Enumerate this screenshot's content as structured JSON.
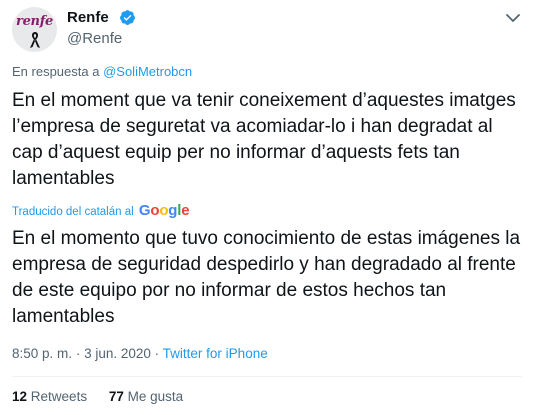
{
  "author": {
    "display_name": "Renfe",
    "handle": "@Renfe",
    "avatar_logo_text": "renfe",
    "verified_icon": "verified-badge-icon",
    "avatar_ribbon_icon": "mourning-ribbon-icon"
  },
  "reply_to": {
    "prefix": "En respuesta a",
    "user": "@SoliMetrobcn"
  },
  "tweet": {
    "text": "En el moment que va tenir coneixement d’aquestes imatges l’empresa de seguretat va acomiadar-lo i han degradat al cap d’aquest equip per no informar d’aquests fets tan lamentables",
    "translated_by": "Traducido del catalán al",
    "translation_provider": "Google",
    "translated_text": "En el momento que tuvo conocimiento de estas imágenes la empresa de seguridad despedirlo y han degradado al frente de este equipo por no informar de estos hechos tan lamentables"
  },
  "meta": {
    "time": "8:50 p. m.",
    "separator": "·",
    "date": "3 jun. 2020",
    "source": "Twitter for iPhone"
  },
  "stats": {
    "retweets_count": "12",
    "retweets_label": "Retweets",
    "likes_count": "77",
    "likes_label": "Me gusta"
  },
  "colors": {
    "accent": "#1d9bf0",
    "text": "#0f1419",
    "secondary": "#536471",
    "brand": "#8a1d6b"
  }
}
